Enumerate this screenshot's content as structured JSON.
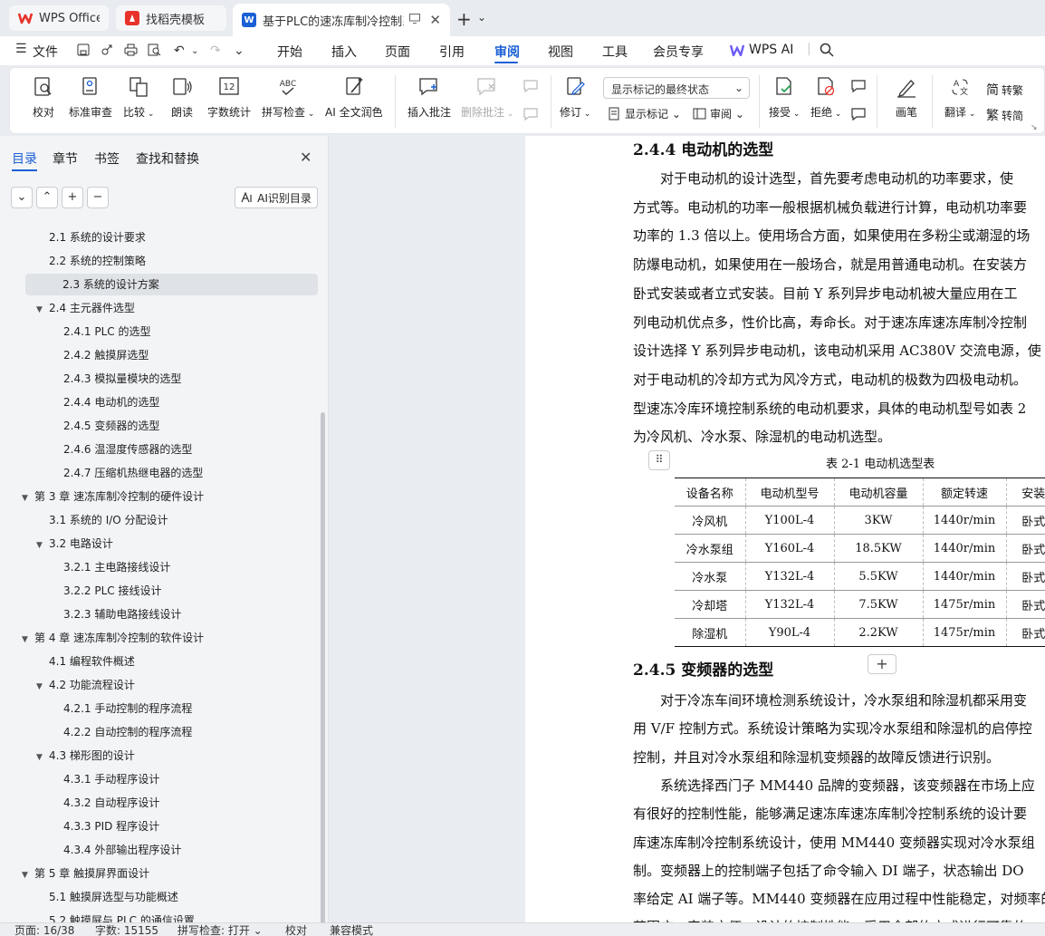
{
  "tabs": [
    {
      "label": "WPS Office",
      "icon": "wps-logo-icon",
      "color": "#e8332a"
    },
    {
      "label": "找稻壳模板",
      "icon": "docer-logo-icon",
      "color": "#e8332a"
    },
    {
      "label": "基于PLC的速冻库制冷控制系",
      "icon": "writer-logo-icon",
      "color": "#1a5fd6"
    }
  ],
  "menu": {
    "file": "文件",
    "items": [
      "开始",
      "插入",
      "页面",
      "引用",
      "审阅",
      "视图",
      "工具",
      "会员专享"
    ],
    "active": "审阅",
    "wps_ai": "WPS AI"
  },
  "ribbon": {
    "proofread": "校对",
    "standard_review": "标准审查",
    "compare": "比较",
    "read_aloud": "朗读",
    "word_count": "字数统计",
    "spell_check": "拼写检查",
    "ai_proofread": "AI 全文润色",
    "insert_comment": "插入批注",
    "delete_comment": "删除批注",
    "track_changes": "修订",
    "markup_select": "显示标记的最终状态",
    "show_markup": "显示标记",
    "review": "审阅",
    "accept": "接受",
    "reject": "拒绝",
    "pen": "画笔",
    "translate": "翻译",
    "to_traditional": "转繁",
    "to_simplified": "转简"
  },
  "panel": {
    "tabs": [
      "目录",
      "章节",
      "书签",
      "查找和替换"
    ],
    "ai_toc": "AI识别目录",
    "toc": [
      {
        "text": "2.1  系统的设计要求",
        "level": 2
      },
      {
        "text": "2.2  系统的控制策略",
        "level": 2
      },
      {
        "text": "2.3  系统的设计方案",
        "level": 2,
        "selected": true
      },
      {
        "text": "2.4  主元器件选型",
        "level": 2,
        "expanded": true
      },
      {
        "text": "2.4.1 PLC 的选型",
        "level": 3
      },
      {
        "text": "2.4.2  触摸屏选型",
        "level": 3
      },
      {
        "text": "2.4.3  模拟量模块的选型",
        "level": 3
      },
      {
        "text": "2.4.4  电动机的选型",
        "level": 3
      },
      {
        "text": "2.4.5  变频器的选型",
        "level": 3
      },
      {
        "text": "2.4.6  温湿度传感器的选型",
        "level": 3
      },
      {
        "text": "2.4.7  压缩机热继电器的选型",
        "level": 3
      },
      {
        "text": "第 3 章  速冻库制冷控制的硬件设计",
        "level": 1,
        "expanded": true
      },
      {
        "text": "3.1  系统的 I/O 分配设计",
        "level": 2
      },
      {
        "text": "3.2  电路设计",
        "level": 2,
        "expanded": true
      },
      {
        "text": "3.2.1  主电路接线设计",
        "level": 3
      },
      {
        "text": "3.2.2 PLC 接线设计",
        "level": 3
      },
      {
        "text": "3.2.3  辅助电路接线设计",
        "level": 3
      },
      {
        "text": "第 4 章  速冻库制冷控制的软件设计",
        "level": 1,
        "expanded": true
      },
      {
        "text": "4.1  编程软件概述",
        "level": 2
      },
      {
        "text": "4.2  功能流程设计",
        "level": 2,
        "expanded": true
      },
      {
        "text": "4.2.1 手动控制的程序流程",
        "level": 3
      },
      {
        "text": "4.2.2 自动控制的程序流程",
        "level": 3
      },
      {
        "text": "4.3  梯形图的设计",
        "level": 2,
        "expanded": true
      },
      {
        "text": "4.3.1 手动程序设计",
        "level": 3
      },
      {
        "text": "4.3.2 自动程序设计",
        "level": 3
      },
      {
        "text": "4.3.3 PID 程序设计",
        "level": 3
      },
      {
        "text": "4.3.4  外部输出程序设计",
        "level": 3
      },
      {
        "text": "第 5 章  触摸屏界面设计",
        "level": 1,
        "expanded": true
      },
      {
        "text": "5.1 触摸屏选型与功能概述",
        "level": 2
      },
      {
        "text": "5.2 触摸屏与 PLC 的通信设置",
        "level": 2
      }
    ]
  },
  "doc": {
    "h244": "2.4.4  电动机的选型",
    "p1": [
      "　　对于电动机的设计选型，首先要考虑电动机的功率要求，使",
      "方式等。电动机的功率一般根据机械负载进行计算，电动机功率要",
      "功率的 1.3 倍以上。使用场合方面，如果使用在多粉尘或潮湿的场",
      "防爆电动机，如果使用在一般场合，就是用普通电动机。在安装方",
      "卧式安装或者立式安装。目前 Y 系列异步电动机被大量应用在工",
      "列电动机优点多，性价比高，寿命长。对于速冻库速冻库制冷控制",
      "设计选择 Y 系列异步电动机，该电动机采用 AC380V 交流电源，使",
      "对于电动机的冷却方式为风冷方式，电动机的极数为四极电动机。",
      "型速冻冷库环境控制系统的电动机要求，具体的电动机型号如表 2",
      "为冷风机、冷水泵、除湿机的电动机选型。"
    ],
    "table_caption": "表 2-1  电动机选型表",
    "table_headers": [
      "设备名称",
      "电动机型号",
      "电动机容量",
      "额定转速",
      "安装"
    ],
    "table_rows": [
      [
        "冷风机",
        "Y100L-4",
        "3KW",
        "1440r/min",
        "卧式"
      ],
      [
        "冷水泵组",
        "Y160L-4",
        "18.5KW",
        "1440r/min",
        "卧式"
      ],
      [
        "冷水泵",
        "Y132L-4",
        "5.5KW",
        "1440r/min",
        "卧式"
      ],
      [
        "冷却塔",
        "Y132L-4",
        "7.5KW",
        "1475r/min",
        "卧式"
      ],
      [
        "除湿机",
        "Y90L-4",
        "2.2KW",
        "1475r/min",
        "卧式"
      ]
    ],
    "h245": "2.4.5  变频器的选型",
    "p2": [
      "　　对于冷冻车间环境检测系统设计，冷水泵组和除湿机都采用变",
      "用 V/F 控制方式。系统设计策略为实现冷水泵组和除湿机的启停控",
      "控制，并且对冷水泵组和除湿机变频器的故障反馈进行识别。",
      "　　系统选择西门子 MM440 品牌的变频器，该变频器在市场上应",
      "有很好的控制性能，能够满足速冻库速冻库制冷控制系统的设计要",
      "库速冻库制冷控制系统设计，使用 MM440 变频器实现对冷水泵组",
      "制。变频器上的控制端子包括了命令输入 DI 端子，状态输出 DO",
      "率给定 AI 端子等。MM440 变频器在应用过程中性能稳定，对频率的",
      "范围广，安装方便，设计的控制性能，采用全部的方式进行可靠的"
    ]
  },
  "status": {
    "page": "页面: 16/38",
    "words": "字数: 15155",
    "spell": "拼写检查: 打开",
    "proof": "校对",
    "compat": "兼容模式"
  }
}
